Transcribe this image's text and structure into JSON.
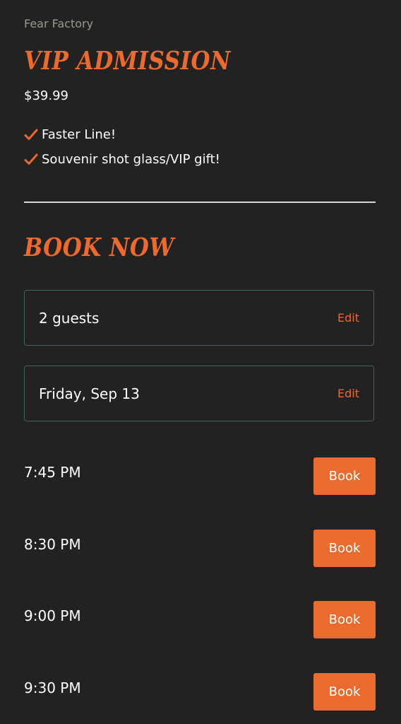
{
  "brand": "Fear Factory",
  "ticket": {
    "title": "VIP Admission",
    "price": "$39.99",
    "features": [
      "Faster Line!",
      "Souvenir shot glass/VIP gift!"
    ]
  },
  "booking": {
    "title": "Book Now",
    "guests": {
      "value": "2 guests",
      "edit_label": "Edit"
    },
    "date": {
      "value": "Friday, Sep 13",
      "edit_label": "Edit"
    },
    "slots": [
      {
        "time": "7:45 PM",
        "button": "Book"
      },
      {
        "time": "8:30 PM",
        "button": "Book"
      },
      {
        "time": "9:00 PM",
        "button": "Book"
      },
      {
        "time": "9:30 PM",
        "button": "Book"
      }
    ]
  },
  "colors": {
    "background": "#222222",
    "accent": "#ec6a2e",
    "field_border": "#3c6663",
    "muted_text": "#9a9a90"
  },
  "icons": {
    "feature_bullet": "checkmark-icon"
  }
}
